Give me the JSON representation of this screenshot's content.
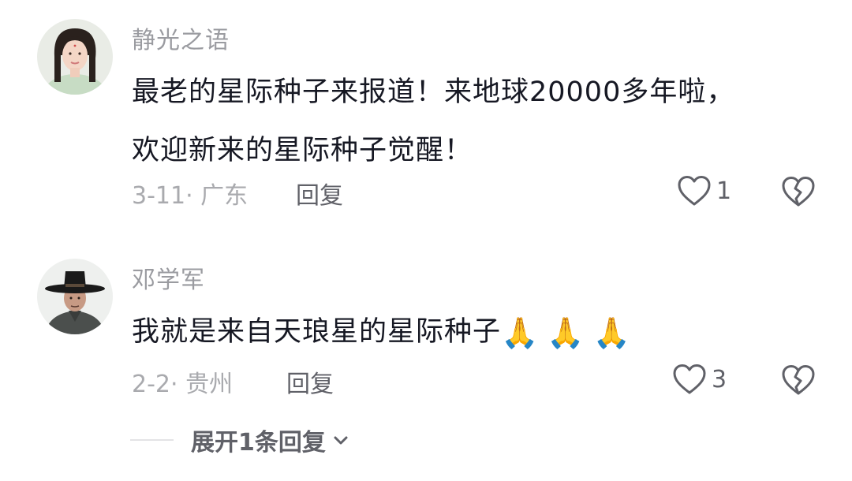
{
  "comments": [
    {
      "username": "静光之语",
      "text_line1": "最老的星际种子来报道！来地球20000多年啦，",
      "text_line2": "欢迎新来的星际种子觉醒！",
      "meta": "3-11· 广东",
      "reply_label": "回复",
      "like_count": "1",
      "avatar": "woman-portrait-avatar"
    },
    {
      "username": "邓学军",
      "text": "我就是来自天琅星的星际种子",
      "emoji": [
        "🙏",
        "🙏",
        "🙏"
      ],
      "meta": "2-2· 贵州",
      "reply_label": "回复",
      "like_count": "3",
      "avatar": "man-in-hat-avatar"
    }
  ],
  "expand_replies": "展开1条回复",
  "icons": {
    "like": "heart-outline-icon",
    "dislike": "broken-heart-icon",
    "expand": "chevron-down-icon"
  },
  "colors": {
    "username": "#9a9ba0",
    "text": "#161823",
    "meta": "#a9aaae",
    "action": "#606168"
  }
}
